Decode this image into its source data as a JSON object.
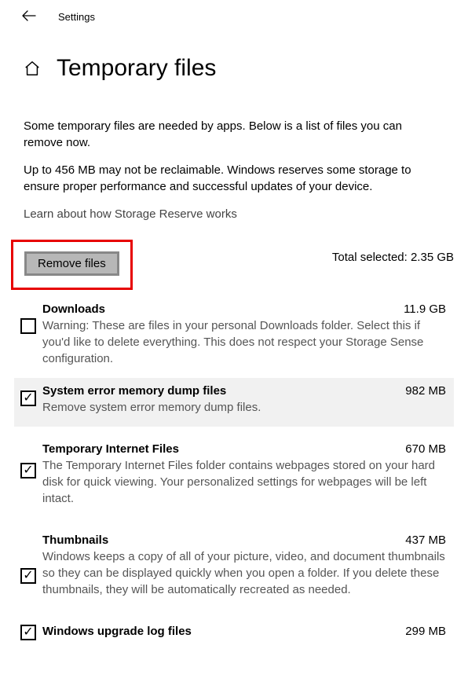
{
  "header": {
    "label": "Settings"
  },
  "page": {
    "title": "Temporary files",
    "intro1": "Some temporary files are needed by apps. Below is a list of files you can remove now.",
    "intro2": "Up to 456 MB may not be reclaimable. Windows reserves some storage to ensure proper performance and successful updates of your device.",
    "link": "Learn about how Storage Reserve works",
    "remove_label": "Remove files",
    "total_label": "Total selected: 2.35 GB"
  },
  "items": [
    {
      "title": "Downloads",
      "size": "11.9 GB",
      "desc": "Warning: These are files in your personal Downloads folder. Select this if you'd like to delete everything. This does not respect your Storage Sense configuration.",
      "checked": false
    },
    {
      "title": "System error memory dump files",
      "size": "982 MB",
      "desc": "Remove system error memory dump files.",
      "checked": true
    },
    {
      "title": "Temporary Internet Files",
      "size": "670 MB",
      "desc": "The Temporary Internet Files folder contains webpages stored on your hard disk for quick viewing. Your personalized settings for webpages will be left intact.",
      "checked": true
    },
    {
      "title": "Thumbnails",
      "size": "437 MB",
      "desc": "Windows keeps a copy of all of your picture, video, and document thumbnails so they can be displayed quickly when you open a folder. If you delete these thumbnails, they will be automatically recreated as needed.",
      "checked": true
    },
    {
      "title": "Windows upgrade log files",
      "size": "299 MB",
      "desc": "",
      "checked": true
    }
  ]
}
